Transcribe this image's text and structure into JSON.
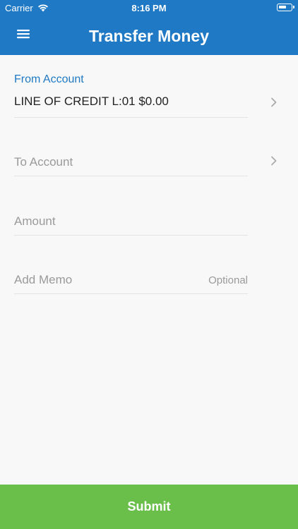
{
  "status_bar": {
    "carrier": "Carrier",
    "time": "8:16 PM",
    "wifi_icon": "wifi-icon",
    "battery_icon": "battery-icon"
  },
  "nav": {
    "menu_icon": "hamburger-menu-icon",
    "title": "Transfer Money"
  },
  "form": {
    "from_account": {
      "label": "From Account",
      "value": "LINE OF CREDIT L:01 $0.00"
    },
    "to_account": {
      "placeholder": "To Account"
    },
    "amount": {
      "placeholder": "Amount"
    },
    "memo": {
      "placeholder": "Add Memo",
      "optional_label": "Optional"
    }
  },
  "submit_label": "Submit",
  "colors": {
    "header": "#1f79c4",
    "label_accent": "#1f79c4",
    "submit": "#6abf4b",
    "background": "#f8f8f8"
  }
}
